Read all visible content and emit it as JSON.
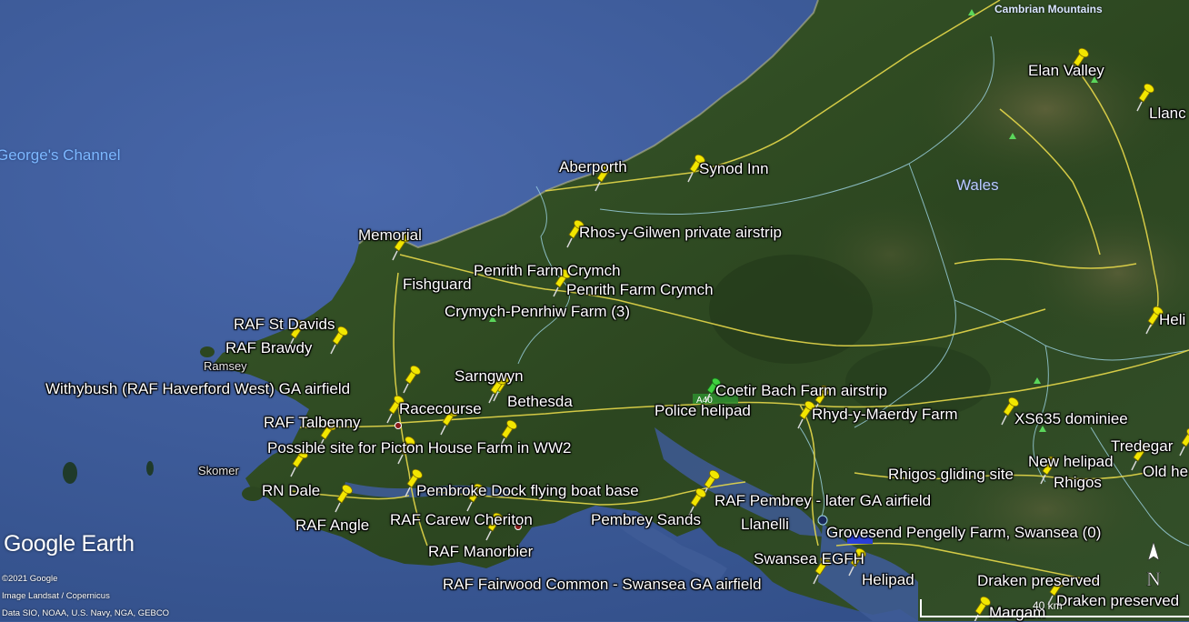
{
  "map": {
    "sea_labels": {
      "channel": "George's Channel"
    },
    "region_labels": {
      "wales": "Wales",
      "cambrian": "Cambrian Mountains"
    },
    "place_labels": {
      "aberporth": "Aberporth",
      "synod_inn": "Synod Inn",
      "rhos": "Rhos-y-Gilwen private airstrip",
      "memorial": "Memorial",
      "penrith1": "Penrith Farm Crymch",
      "fishguard": "Fishguard",
      "penrith2": "Penrith Farm Crymch",
      "crymych": "Crymych-Penrhiw Farm (3)",
      "st_davids": "RAF St Davids",
      "brawdy": "RAF Brawdy",
      "ramsey": "Ramsey",
      "sarngwyn": "Sarngwyn",
      "withybush": "Withybush (RAF Haverford West) GA airfield",
      "bethesda": "Bethesda",
      "racecourse": "Racecourse",
      "coetir": "Coetir Bach Farm airstrip",
      "police": "Police helipad",
      "rhyd": "Rhyd-y-Maerdy Farm",
      "xs635": "XS635 dominiee",
      "talbenny": "RAF Talbenny",
      "picton": "Possible site for Picton House Farm in WW2",
      "skomer": "Skomer",
      "rn_dale": "RN Dale",
      "pembroke": "Pembroke Dock flying boat base",
      "pembrey": "RAF Pembrey - later GA airfield",
      "angle": "RAF Angle",
      "carew": "RAF Carew Cheriton",
      "pembrey_sands": "Pembrey Sands",
      "llanelli": "Llanelli",
      "manorbier": "RAF Manorbier",
      "grovesend": "Grovesend Pengelly Farm, Swansea (0)",
      "swansea_egfh": "Swansea EGFH",
      "helipad": "Helipad",
      "fairwood": "RAF Fairwood Common - Swansea GA airfield",
      "draken1": "Draken preserved",
      "draken2": "Draken preserved",
      "margam": "Margam",
      "elan": "Elan Valley",
      "llanc": "Llanc",
      "heli": "Heli",
      "tredegar": "Tredegar",
      "new_helipad": "New helipad",
      "rhigos_site": "Rhigos gliding site",
      "rhigos": "Rhigos",
      "old_he": "Old he"
    }
  },
  "branding": {
    "logo": "Google Earth",
    "attribution": [
      "©2021 Google",
      "Image Landsat / Copernicus",
      "Data SIO, NOAA, U.S. Navy, NGA, GEBCO"
    ]
  },
  "controls": {
    "compass_letter": "N",
    "scale_text": "40 km"
  },
  "colors": {
    "sea": "#3e5b96",
    "land": "#2f4a22",
    "pin": "#f2e600",
    "road": "#e6d84a",
    "border": "#9fd6e6"
  }
}
